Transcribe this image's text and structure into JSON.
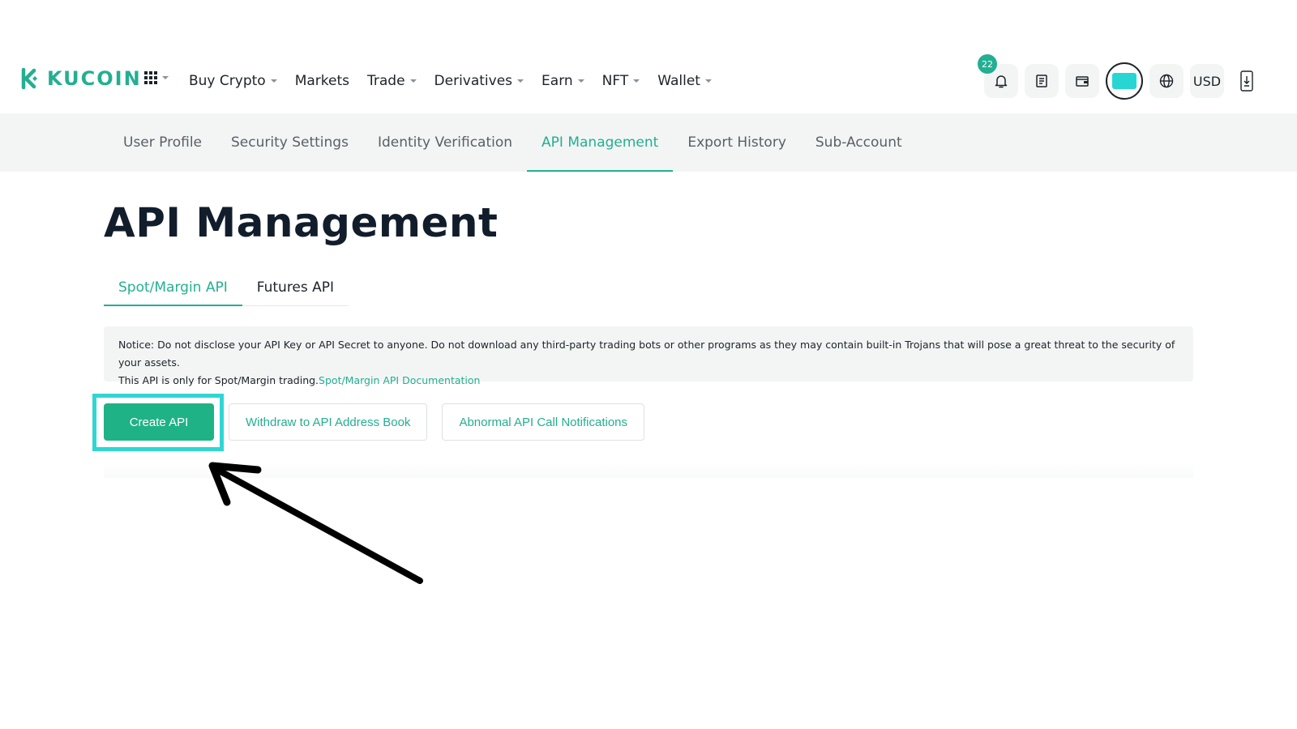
{
  "brand": {
    "name": "KUCOIN",
    "color": "#23af91"
  },
  "nav": {
    "items": [
      {
        "label": "Buy Crypto",
        "dropdown": true
      },
      {
        "label": "Markets",
        "dropdown": false
      },
      {
        "label": "Trade",
        "dropdown": true
      },
      {
        "label": "Derivatives",
        "dropdown": true
      },
      {
        "label": "Earn",
        "dropdown": true
      },
      {
        "label": "NFT",
        "dropdown": true
      },
      {
        "label": "Wallet",
        "dropdown": true
      }
    ],
    "notification_count": "22",
    "currency": "USD",
    "icons": [
      "apps-grid-icon",
      "bell-icon",
      "orders-icon",
      "wallet-icon",
      "avatar",
      "globe-icon",
      "download-app-icon"
    ]
  },
  "subnav": {
    "tabs": [
      {
        "label": "User Profile"
      },
      {
        "label": "Security Settings"
      },
      {
        "label": "Identity Verification"
      },
      {
        "label": "API Management",
        "active": true
      },
      {
        "label": "Export History"
      },
      {
        "label": "Sub-Account"
      }
    ]
  },
  "main": {
    "title": "API Management",
    "api_tabs": [
      {
        "label": "Spot/Margin API",
        "active": true
      },
      {
        "label": "Futures API"
      }
    ],
    "notice": {
      "text": "Notice: Do not disclose your API Key or API Secret to anyone. Do not download any third-party trading bots or other programs as they may contain built-in Trojans that will pose a great threat to the security of your assets.",
      "text2": "This API is only for Spot/Margin trading.",
      "link": "Spot/Margin API Documentation"
    },
    "buttons": {
      "create": "Create API",
      "withdraw_book": "Withdraw to API Address Book",
      "abnormal": "Abnormal API Call Notifications"
    }
  },
  "annotation": {
    "highlight_color": "#2fd6d4",
    "arrow_color": "#000000"
  }
}
